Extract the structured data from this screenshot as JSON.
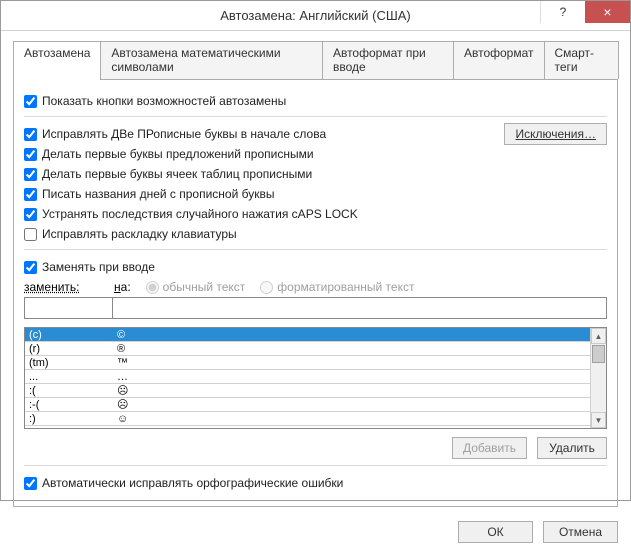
{
  "title": "Автозамена: Английский (США)",
  "tb": {
    "help": "?",
    "close": "×"
  },
  "tabs": {
    "t0": "Автозамена",
    "t1": "Автозамена математическими символами",
    "t2": "Автоформат при вводе",
    "t3": "Автоформат",
    "t4": "Смарт-теги"
  },
  "opts": {
    "show_buttons": "Показать кнопки возможностей автозамены",
    "two_caps": "Исправлять ДВе ПРописные буквы в начале слова",
    "sentence_caps": "Делать первые буквы предложений прописными",
    "table_cell_caps": "Делать первые буквы ячеек таблиц прописными",
    "day_names": "Писать названия дней с прописной буквы",
    "caps_lock": "Устранять последствия случайного нажатия cAPS LOCK",
    "keyboard_layout": "Исправлять раскладку клавиатуры",
    "replace_on_type": "Заменять при вводе",
    "exceptions": "Исключения…"
  },
  "cols": {
    "replace_label": "заменить:",
    "with_label_prefix": "н",
    "with_label_rest": "а:",
    "radio_plain": "обычный текст",
    "radio_formatted": "форматированный текст"
  },
  "list": {
    "r0": {
      "a": "(c)",
      "b": "©"
    },
    "r1": {
      "a": "(r)",
      "b": "®"
    },
    "r2": {
      "a": "(tm)",
      "b": "™"
    },
    "r3": {
      "a": "...",
      "b": "…"
    },
    "r4": {
      "a": ":(",
      "b": "☹"
    },
    "r5": {
      "a": ":-(",
      "b": "☹"
    },
    "r6": {
      "a": ":)",
      "b": "☺"
    }
  },
  "actions": {
    "add": "Добавить",
    "delete": "Удалить"
  },
  "auto_spell": "Автоматически исправлять орфографические ошибки",
  "footer": {
    "ok": "ОК",
    "cancel": "Отмена"
  }
}
